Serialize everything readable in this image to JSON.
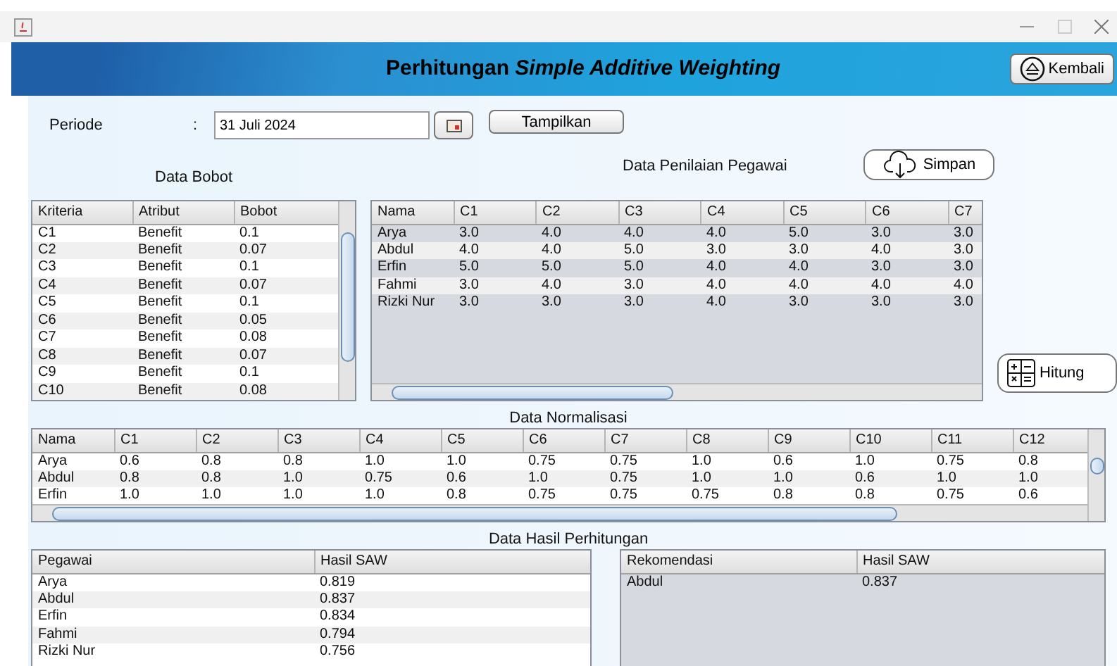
{
  "header": {
    "title": "Perhitungan *Simple Additive Weighting*",
    "back_button": "Kembali"
  },
  "periode": {
    "label": "Periode",
    "separator": ":",
    "value": "31 Juli 2024",
    "show_button": "Tampilkan"
  },
  "save_button": "Simpan",
  "calc_button": "Hitung",
  "bobot": {
    "title": "Data Bobot",
    "columns": [
      "Kriteria",
      "Atribut",
      "Bobot"
    ],
    "rows": [
      [
        "C1",
        "Benefit",
        "0.1"
      ],
      [
        "C2",
        "Benefit",
        "0.07"
      ],
      [
        "C3",
        "Benefit",
        "0.1"
      ],
      [
        "C4",
        "Benefit",
        "0.07"
      ],
      [
        "C5",
        "Benefit",
        "0.1"
      ],
      [
        "C6",
        "Benefit",
        "0.05"
      ],
      [
        "C7",
        "Benefit",
        "0.08"
      ],
      [
        "C8",
        "Benefit",
        "0.07"
      ],
      [
        "C9",
        "Benefit",
        "0.1"
      ],
      [
        "C10",
        "Benefit",
        "0.08"
      ]
    ]
  },
  "penilaian": {
    "title": "Data Penilaian Pegawai",
    "columns": [
      "Nama",
      "C1",
      "C2",
      "C3",
      "C4",
      "C5",
      "C6",
      "C7"
    ],
    "rows": [
      [
        "Arya",
        "3.0",
        "4.0",
        "4.0",
        "4.0",
        "5.0",
        "3.0",
        "3.0"
      ],
      [
        "Abdul",
        "4.0",
        "4.0",
        "5.0",
        "3.0",
        "3.0",
        "4.0",
        "3.0"
      ],
      [
        "Erfin",
        "5.0",
        "5.0",
        "5.0",
        "4.0",
        "4.0",
        "3.0",
        "3.0"
      ],
      [
        "Fahmi",
        "3.0",
        "4.0",
        "3.0",
        "4.0",
        "4.0",
        "4.0",
        "4.0"
      ],
      [
        "Rizki Nur",
        "3.0",
        "3.0",
        "3.0",
        "4.0",
        "3.0",
        "3.0",
        "3.0"
      ]
    ]
  },
  "normalisasi": {
    "title": "Data Normalisasi",
    "columns": [
      "Nama",
      "C1",
      "C2",
      "C3",
      "C4",
      "C5",
      "C6",
      "C7",
      "C8",
      "C9",
      "C10",
      "C11",
      "C12"
    ],
    "rows": [
      [
        "Arya",
        "0.6",
        "0.8",
        "0.8",
        "1.0",
        "1.0",
        "0.75",
        "0.75",
        "1.0",
        "0.6",
        "1.0",
        "0.75",
        "0.8"
      ],
      [
        "Abdul",
        "0.8",
        "0.8",
        "1.0",
        "0.75",
        "0.6",
        "1.0",
        "0.75",
        "1.0",
        "1.0",
        "0.6",
        "1.0",
        "1.0"
      ],
      [
        "Erfin",
        "1.0",
        "1.0",
        "1.0",
        "1.0",
        "0.8",
        "0.75",
        "0.75",
        "0.75",
        "0.8",
        "0.8",
        "0.75",
        "0.6"
      ]
    ]
  },
  "hasil_title": "Data Hasil Perhitungan",
  "hasil": {
    "columns": [
      "Pegawai",
      "Hasil SAW"
    ],
    "rows": [
      [
        "Arya",
        "0.819"
      ],
      [
        "Abdul",
        "0.837"
      ],
      [
        "Erfin",
        "0.834"
      ],
      [
        "Fahmi",
        "0.794"
      ],
      [
        "Rizki Nur",
        "0.756"
      ]
    ]
  },
  "rekomendasi": {
    "columns": [
      "Rekomendasi",
      "Hasil SAW"
    ],
    "rows": [
      [
        "Abdul",
        "0.837"
      ]
    ]
  }
}
